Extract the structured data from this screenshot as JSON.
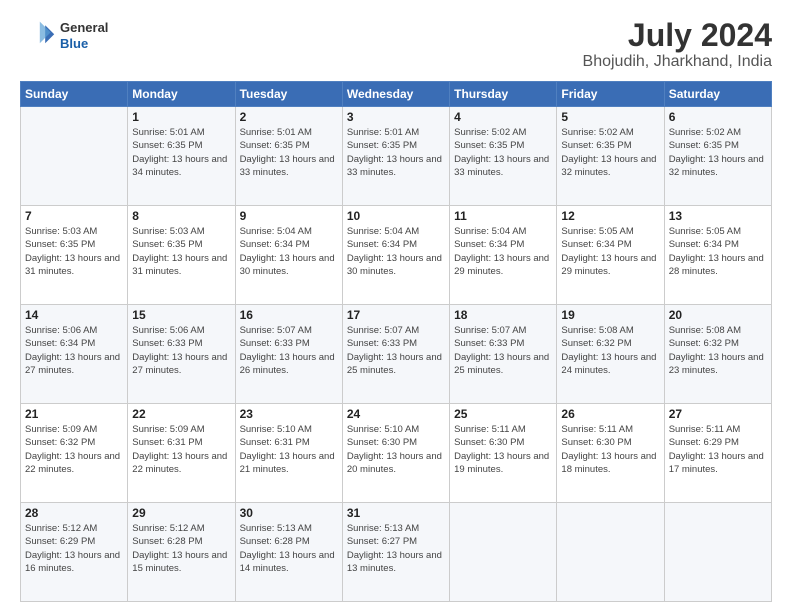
{
  "header": {
    "logo_line1": "General",
    "logo_line2": "Blue",
    "title": "July 2024",
    "subtitle": "Bhojudih, Jharkhand, India"
  },
  "days_of_week": [
    "Sunday",
    "Monday",
    "Tuesday",
    "Wednesday",
    "Thursday",
    "Friday",
    "Saturday"
  ],
  "weeks": [
    [
      {
        "num": "",
        "sunrise": "",
        "sunset": "",
        "daylight": ""
      },
      {
        "num": "1",
        "sunrise": "Sunrise: 5:01 AM",
        "sunset": "Sunset: 6:35 PM",
        "daylight": "Daylight: 13 hours and 34 minutes."
      },
      {
        "num": "2",
        "sunrise": "Sunrise: 5:01 AM",
        "sunset": "Sunset: 6:35 PM",
        "daylight": "Daylight: 13 hours and 33 minutes."
      },
      {
        "num": "3",
        "sunrise": "Sunrise: 5:01 AM",
        "sunset": "Sunset: 6:35 PM",
        "daylight": "Daylight: 13 hours and 33 minutes."
      },
      {
        "num": "4",
        "sunrise": "Sunrise: 5:02 AM",
        "sunset": "Sunset: 6:35 PM",
        "daylight": "Daylight: 13 hours and 33 minutes."
      },
      {
        "num": "5",
        "sunrise": "Sunrise: 5:02 AM",
        "sunset": "Sunset: 6:35 PM",
        "daylight": "Daylight: 13 hours and 32 minutes."
      },
      {
        "num": "6",
        "sunrise": "Sunrise: 5:02 AM",
        "sunset": "Sunset: 6:35 PM",
        "daylight": "Daylight: 13 hours and 32 minutes."
      }
    ],
    [
      {
        "num": "7",
        "sunrise": "Sunrise: 5:03 AM",
        "sunset": "Sunset: 6:35 PM",
        "daylight": "Daylight: 13 hours and 31 minutes."
      },
      {
        "num": "8",
        "sunrise": "Sunrise: 5:03 AM",
        "sunset": "Sunset: 6:35 PM",
        "daylight": "Daylight: 13 hours and 31 minutes."
      },
      {
        "num": "9",
        "sunrise": "Sunrise: 5:04 AM",
        "sunset": "Sunset: 6:34 PM",
        "daylight": "Daylight: 13 hours and 30 minutes."
      },
      {
        "num": "10",
        "sunrise": "Sunrise: 5:04 AM",
        "sunset": "Sunset: 6:34 PM",
        "daylight": "Daylight: 13 hours and 30 minutes."
      },
      {
        "num": "11",
        "sunrise": "Sunrise: 5:04 AM",
        "sunset": "Sunset: 6:34 PM",
        "daylight": "Daylight: 13 hours and 29 minutes."
      },
      {
        "num": "12",
        "sunrise": "Sunrise: 5:05 AM",
        "sunset": "Sunset: 6:34 PM",
        "daylight": "Daylight: 13 hours and 29 minutes."
      },
      {
        "num": "13",
        "sunrise": "Sunrise: 5:05 AM",
        "sunset": "Sunset: 6:34 PM",
        "daylight": "Daylight: 13 hours and 28 minutes."
      }
    ],
    [
      {
        "num": "14",
        "sunrise": "Sunrise: 5:06 AM",
        "sunset": "Sunset: 6:34 PM",
        "daylight": "Daylight: 13 hours and 27 minutes."
      },
      {
        "num": "15",
        "sunrise": "Sunrise: 5:06 AM",
        "sunset": "Sunset: 6:33 PM",
        "daylight": "Daylight: 13 hours and 27 minutes."
      },
      {
        "num": "16",
        "sunrise": "Sunrise: 5:07 AM",
        "sunset": "Sunset: 6:33 PM",
        "daylight": "Daylight: 13 hours and 26 minutes."
      },
      {
        "num": "17",
        "sunrise": "Sunrise: 5:07 AM",
        "sunset": "Sunset: 6:33 PM",
        "daylight": "Daylight: 13 hours and 25 minutes."
      },
      {
        "num": "18",
        "sunrise": "Sunrise: 5:07 AM",
        "sunset": "Sunset: 6:33 PM",
        "daylight": "Daylight: 13 hours and 25 minutes."
      },
      {
        "num": "19",
        "sunrise": "Sunrise: 5:08 AM",
        "sunset": "Sunset: 6:32 PM",
        "daylight": "Daylight: 13 hours and 24 minutes."
      },
      {
        "num": "20",
        "sunrise": "Sunrise: 5:08 AM",
        "sunset": "Sunset: 6:32 PM",
        "daylight": "Daylight: 13 hours and 23 minutes."
      }
    ],
    [
      {
        "num": "21",
        "sunrise": "Sunrise: 5:09 AM",
        "sunset": "Sunset: 6:32 PM",
        "daylight": "Daylight: 13 hours and 22 minutes."
      },
      {
        "num": "22",
        "sunrise": "Sunrise: 5:09 AM",
        "sunset": "Sunset: 6:31 PM",
        "daylight": "Daylight: 13 hours and 22 minutes."
      },
      {
        "num": "23",
        "sunrise": "Sunrise: 5:10 AM",
        "sunset": "Sunset: 6:31 PM",
        "daylight": "Daylight: 13 hours and 21 minutes."
      },
      {
        "num": "24",
        "sunrise": "Sunrise: 5:10 AM",
        "sunset": "Sunset: 6:30 PM",
        "daylight": "Daylight: 13 hours and 20 minutes."
      },
      {
        "num": "25",
        "sunrise": "Sunrise: 5:11 AM",
        "sunset": "Sunset: 6:30 PM",
        "daylight": "Daylight: 13 hours and 19 minutes."
      },
      {
        "num": "26",
        "sunrise": "Sunrise: 5:11 AM",
        "sunset": "Sunset: 6:30 PM",
        "daylight": "Daylight: 13 hours and 18 minutes."
      },
      {
        "num": "27",
        "sunrise": "Sunrise: 5:11 AM",
        "sunset": "Sunset: 6:29 PM",
        "daylight": "Daylight: 13 hours and 17 minutes."
      }
    ],
    [
      {
        "num": "28",
        "sunrise": "Sunrise: 5:12 AM",
        "sunset": "Sunset: 6:29 PM",
        "daylight": "Daylight: 13 hours and 16 minutes."
      },
      {
        "num": "29",
        "sunrise": "Sunrise: 5:12 AM",
        "sunset": "Sunset: 6:28 PM",
        "daylight": "Daylight: 13 hours and 15 minutes."
      },
      {
        "num": "30",
        "sunrise": "Sunrise: 5:13 AM",
        "sunset": "Sunset: 6:28 PM",
        "daylight": "Daylight: 13 hours and 14 minutes."
      },
      {
        "num": "31",
        "sunrise": "Sunrise: 5:13 AM",
        "sunset": "Sunset: 6:27 PM",
        "daylight": "Daylight: 13 hours and 13 minutes."
      },
      {
        "num": "",
        "sunrise": "",
        "sunset": "",
        "daylight": ""
      },
      {
        "num": "",
        "sunrise": "",
        "sunset": "",
        "daylight": ""
      },
      {
        "num": "",
        "sunrise": "",
        "sunset": "",
        "daylight": ""
      }
    ]
  ]
}
